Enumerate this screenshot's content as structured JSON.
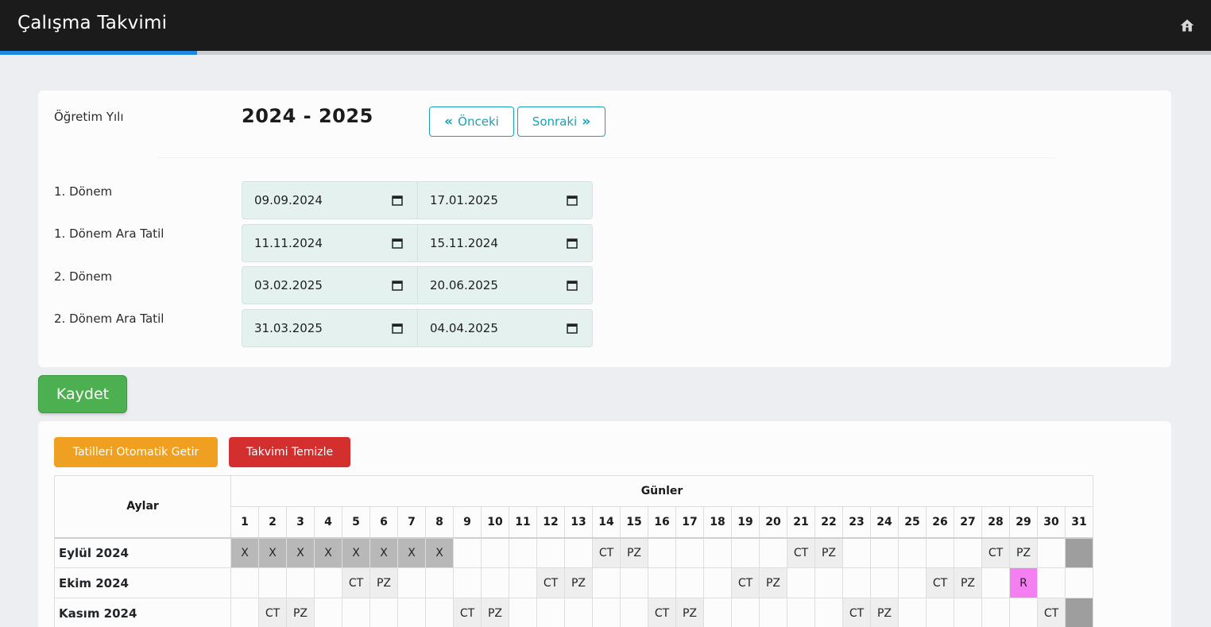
{
  "header": {
    "title": "Çalışma Takvimi",
    "home_icon": "home-icon",
    "progress_fraction": 0.163
  },
  "form": {
    "year_label": "Öğretim Yılı",
    "year_value": "2024 - 2025",
    "prev_label": "Önceki",
    "next_label": "Sonraki",
    "prev_icon": "double-chevron-left-icon",
    "next_icon": "double-chevron-right-icon",
    "rows": [
      {
        "label": "1. Dönem",
        "start": "09.09.2024",
        "end": "17.01.2025"
      },
      {
        "label": "1. Dönem Ara Tatil",
        "start": "11.11.2024",
        "end": "15.11.2024"
      },
      {
        "label": "2. Dönem",
        "start": "03.02.2025",
        "end": "20.06.2025"
      },
      {
        "label": "2. Dönem Ara Tatil",
        "start": "31.03.2025",
        "end": "04.04.2025"
      }
    ],
    "save_label": "Kaydet"
  },
  "actions": {
    "auto_label": "Tatilleri Otomatik Getir",
    "clear_label": "Takvimi Temizle"
  },
  "calendar": {
    "months_header": "Aylar",
    "days_header": "Günler",
    "days": [
      "1",
      "2",
      "3",
      "4",
      "5",
      "6",
      "7",
      "8",
      "9",
      "10",
      "11",
      "12",
      "13",
      "14",
      "15",
      "16",
      "17",
      "18",
      "19",
      "20",
      "21",
      "22",
      "23",
      "24",
      "25",
      "26",
      "27",
      "28",
      "29",
      "30",
      "31"
    ],
    "rows": [
      {
        "month": "Eylül 2024",
        "cells": [
          "X",
          "X",
          "X",
          "X",
          "X",
          "X",
          "X",
          "X",
          "",
          "",
          "",
          "",
          "",
          "CT",
          "PZ",
          "",
          "",
          "",
          "",
          "",
          "CT",
          "PZ",
          "",
          "",
          "",
          "",
          "",
          "CT",
          "PZ",
          "",
          ""
        ]
      },
      {
        "month": "Ekim 2024",
        "cells": [
          "",
          "",
          "",
          "",
          "CT",
          "PZ",
          "",
          "",
          "",
          "",
          "",
          "CT",
          "PZ",
          "",
          "",
          "",
          "",
          "",
          "CT",
          "PZ",
          "",
          "",
          "",
          "",
          "",
          "CT",
          "PZ",
          "",
          "R",
          "",
          ""
        ]
      },
      {
        "month": "Kasım 2024",
        "cells": [
          "",
          "CT",
          "PZ",
          "",
          "",
          "",
          "",
          "",
          "CT",
          "PZ",
          "",
          "",
          "",
          "",
          "",
          "CT",
          "PZ",
          "",
          "",
          "",
          "",
          "",
          "CT",
          "PZ",
          "",
          "",
          "",
          "",
          "",
          "CT",
          ""
        ]
      }
    ],
    "cell_colors": {
      "holiday": "#b8b8b8",
      "weekend": "#eeeeee",
      "special": "#f47ff0",
      "disabled": "#9e9e9e"
    }
  }
}
